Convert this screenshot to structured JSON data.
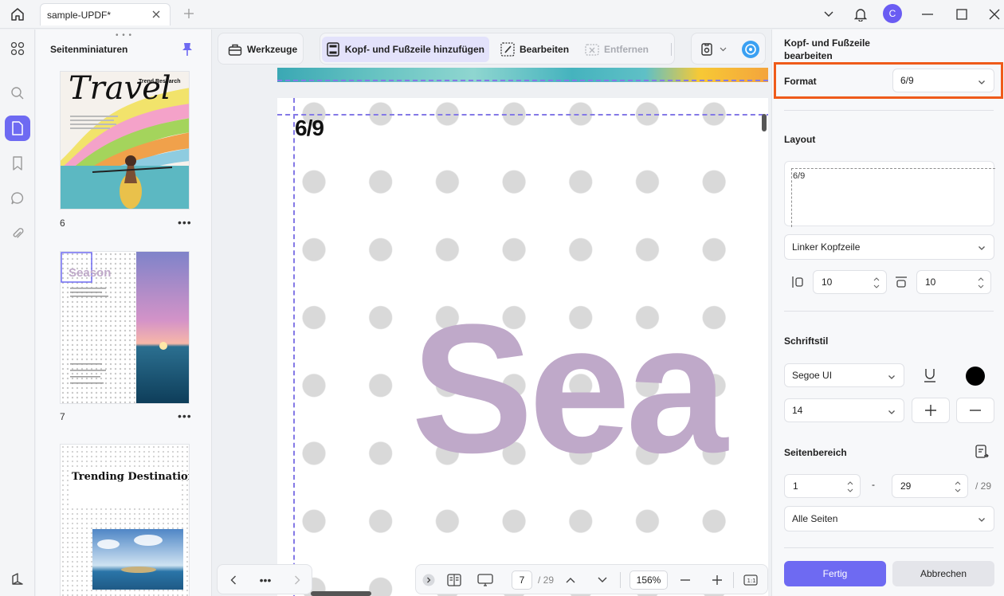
{
  "titlebar": {
    "tab_title": "sample-UPDF*",
    "avatar_letter": "C"
  },
  "thumbnails": {
    "title": "Seitenminiaturen",
    "pages": [
      {
        "number": "6",
        "heading": "Travel",
        "subtitle": "Trend Research"
      },
      {
        "number": "7",
        "heading": "Season"
      },
      {
        "heading": "Trending Destinations"
      }
    ]
  },
  "toolbar": {
    "tools_label": "Werkzeuge",
    "header_footer_label": "Kopf- und Fußzeile hinzufügen",
    "edit_label": "Bearbeiten",
    "remove_label": "Entfernen"
  },
  "document": {
    "header_text": "6/9",
    "body_text": "Sea"
  },
  "pager": {
    "current_page": "7",
    "total_pages": "/ 29",
    "zoom": "156%"
  },
  "right_panel": {
    "title": "Kopf- und Fußzeile bearbeiten",
    "format_label": "Format",
    "format_value": "6/9",
    "layout_label": "Layout",
    "layout_preview_text": "6/9",
    "position_value": "Linker Kopfzeile",
    "margin_left_value": "10",
    "margin_top_value": "10",
    "font_style_label": "Schriftstil",
    "font_value": "Segoe UI",
    "font_size_value": "14",
    "font_color": "#000000",
    "page_range_label": "Seitenbereich",
    "range_from": "1",
    "range_sep": "-",
    "range_to": "29",
    "range_total": "/ 29",
    "pages_value": "Alle Seiten",
    "done_label": "Fertig",
    "cancel_label": "Abbrechen"
  },
  "colors": {
    "accent": "#6e6af2",
    "highlight_border": "#ef5b1a",
    "guide_dash": "#8479e6",
    "watermark_text": "#bfa9c9"
  }
}
